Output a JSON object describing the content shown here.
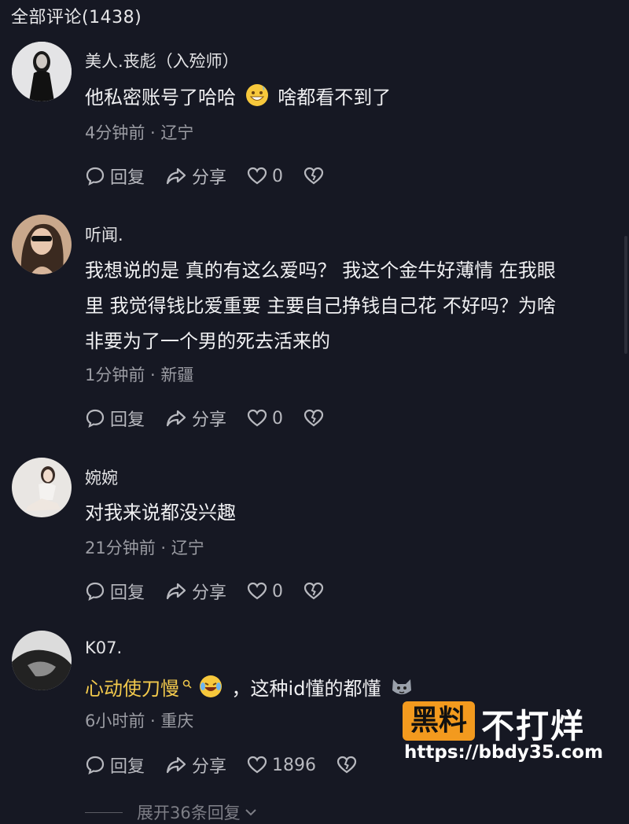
{
  "header": {
    "title": "全部评论(1438)"
  },
  "labels": {
    "reply": "回复",
    "share": "分享"
  },
  "comments": [
    {
      "username": "美人.丧彪（入殓师）",
      "text_before": "他私密账号了哈哈",
      "text_after": "啥都看不到了",
      "time_location": "4分钟前 · 辽宁",
      "likes": "0"
    },
    {
      "username": "听闻.",
      "lines": [
        "我想说的是 真的有这么爱吗？ 我这个金牛好薄情 在我眼",
        "里 我觉得钱比爱重要 主要自己挣钱自己花 不好吗？为啥",
        "非要为了一个男的死去活来的"
      ],
      "time_location": "1分钟前 · 新疆",
      "likes": "0"
    },
    {
      "username": "婉婉",
      "text": "对我来说都没兴趣",
      "time_location": "21分钟前 · 辽宁",
      "likes": "0"
    },
    {
      "username": "K07.",
      "highlight": "心动使刀慢",
      "text_after": "，这种id懂的都懂",
      "time_location": "6小时前 · 重庆",
      "likes": "1896"
    }
  ],
  "expand": {
    "label": "展开36条回复"
  },
  "watermark": {
    "badge": "黑料",
    "title": "不打烊",
    "url": "https://bbdy35.com"
  },
  "colors": {
    "background": "#161823",
    "highlight": "#f2c94c",
    "watermark_badge": "#f39a1e"
  }
}
